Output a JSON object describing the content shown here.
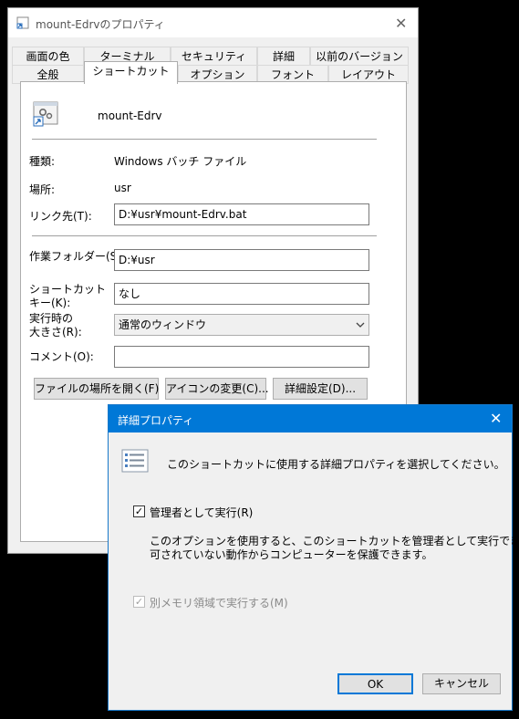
{
  "main_window": {
    "title": "mount-Edrvのプロパティ",
    "tabs_row1": [
      "画面の色",
      "ターミナル",
      "セキュリティ",
      "詳細",
      "以前のバージョン"
    ],
    "tabs_row2": [
      "全般",
      "ショートカット",
      "オプション",
      "フォント",
      "レイアウト"
    ],
    "active_tab": "ショートカット",
    "shortcut_name": "mount-Edrv",
    "type_label": "種類:",
    "type_value": "Windows バッチ ファイル",
    "location_label": "場所:",
    "location_value": "usr",
    "target_label": "リンク先(T):",
    "target_value": "D:¥usr¥mount-Edrv.bat",
    "workdir_label": "作業フォルダー(S):",
    "workdir_value": "D:¥usr",
    "shortcut_key_label_1": "ショートカット",
    "shortcut_key_label_2": "キー(K):",
    "shortcut_key_value": "なし",
    "run_label_1": "実行時の",
    "run_label_2": "大きさ(R):",
    "run_value": "通常のウィンドウ",
    "comment_label": "コメント(O):",
    "comment_value": "",
    "open_location_button": "ファイルの場所を開く(F)",
    "change_icon_button": "アイコンの変更(C)...",
    "advanced_button": "詳細設定(D)..."
  },
  "dialog": {
    "title": "詳細プロパティ",
    "intro": "このショートカットに使用する詳細プロパティを選択してください。",
    "run_as_admin_label": "管理者として実行(R)",
    "run_as_admin_checked": true,
    "desc_line1": "このオプションを使用すると、このショートカットを管理者として実行でき、許",
    "desc_line2": "可されていない動作からコンピューターを保護できます。",
    "separate_memory_label": "別メモリ領域で実行する(M)",
    "separate_memory_checked": true,
    "ok_button": "OK",
    "cancel_button": "キャンセル"
  },
  "colors": {
    "title_bar": "#0078d7",
    "window_bg": "#f0f0f0",
    "panel_bg": "#ffffff"
  }
}
